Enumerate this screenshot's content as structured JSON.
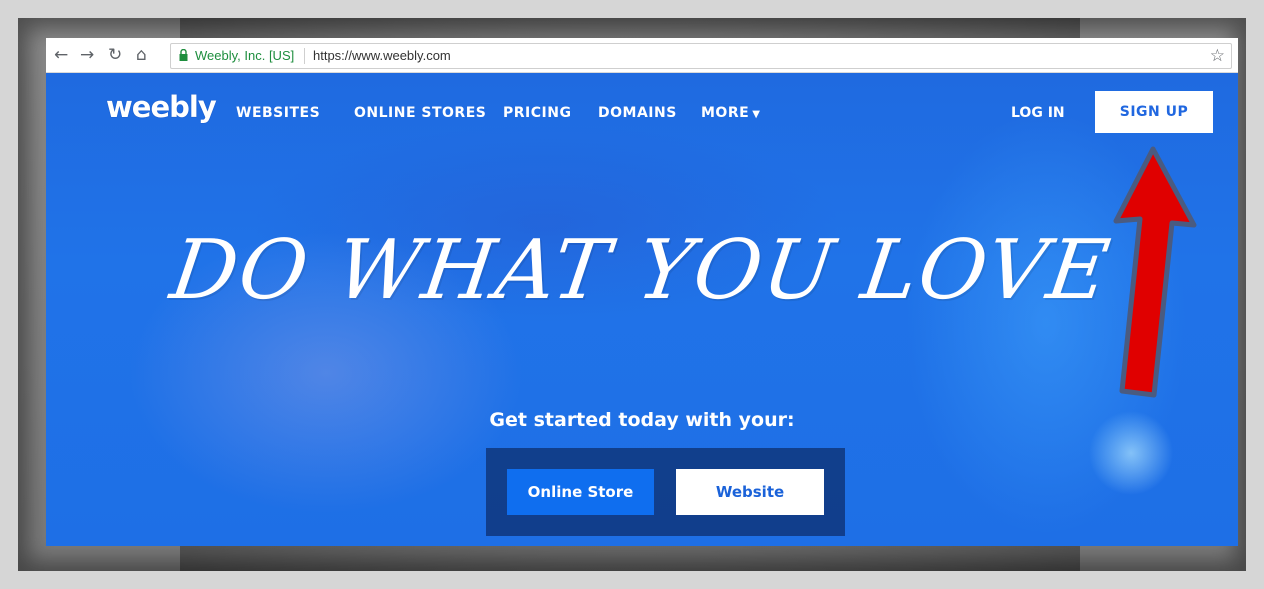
{
  "browser": {
    "back_icon": "arrow-left-icon",
    "forward_icon": "arrow-right-icon",
    "reload_icon": "reload-icon",
    "home_icon": "home-icon",
    "site_identity": "Weebly, Inc. [US]",
    "url": "https://www.weebly.com",
    "bookmark_icon": "star-icon"
  },
  "header": {
    "logo": "weebly",
    "nav": [
      "WEBSITES",
      "ONLINE STORES",
      "PRICING",
      "DOMAINS",
      "MORE"
    ],
    "more_caret": "▼",
    "login": "LOG IN",
    "signup": "SIGN UP"
  },
  "hero": {
    "headline": "DO WHAT YOU LOVE",
    "subtitle": "Get started today with your:",
    "buttons": {
      "online_store": "Online Store",
      "website": "Website"
    }
  },
  "annotation": {
    "arrow_color": "#e00000",
    "arrow_outline": "#4a5b80"
  },
  "colors": {
    "hero_blue": "#2073e8",
    "button_blue": "#0f6eef"
  }
}
